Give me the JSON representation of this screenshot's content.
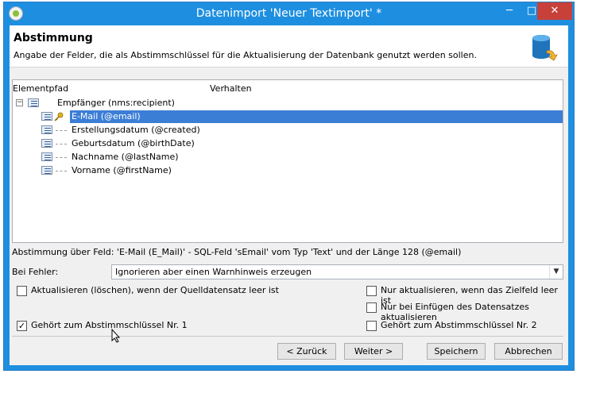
{
  "window": {
    "title": "Datenimport 'Neuer Textimport' *",
    "minimize": "─",
    "maximize": "□",
    "close": "✕"
  },
  "header": {
    "title": "Abstimmung",
    "subtitle": "Angabe der Felder, die als Abstimmschlüssel für die Aktualisierung der Datenbank genutzt werden sollen.",
    "icon": "database-sync-icon"
  },
  "tree": {
    "columns": [
      "Elementpfad",
      "Verhalten"
    ],
    "root": {
      "label": "Empfänger (nms:recipient)",
      "expander": "−"
    },
    "items": [
      {
        "label": "E-Mail (@email)",
        "selected": true
      },
      {
        "label": "Erstellungsdatum (@created)"
      },
      {
        "label": "Geburtsdatum (@birthDate)"
      },
      {
        "label": "Nachname (@lastName)"
      },
      {
        "label": "Vorname (@firstName)"
      }
    ]
  },
  "info_text": "Abstimmung über Feld: 'E-Mail (E_Mail)' - SQL-Feld 'sEmail' vom Typ 'Text' und der Länge 128 (@email)",
  "error": {
    "label": "Bei Fehler:",
    "value": "Ignorieren aber einen Warnhinweis erzeugen"
  },
  "options": {
    "update_empty": {
      "label": "Aktualisieren (löschen), wenn der Quelldatensatz leer ist",
      "checked": false
    },
    "only_if_empty": {
      "label": "Nur aktualisieren, wenn das Zielfeld leer ist",
      "checked": false
    },
    "only_on_insert": {
      "label": "Nur bei Einfügen des Datensatzes aktualisieren",
      "checked": false
    },
    "key1": {
      "label": "Gehört zum Abstimmschlüssel Nr. 1",
      "checked": true
    },
    "key2": {
      "label": "Gehört zum Abstimmschlüssel Nr. 2",
      "checked": false
    }
  },
  "buttons": {
    "back": "< Zurück",
    "next": "Weiter >",
    "save": "Speichern",
    "cancel": "Abbrechen"
  },
  "colors": {
    "titlebar": "#1e8fe0",
    "selection": "#3b7ed6",
    "close": "#c7413a"
  }
}
